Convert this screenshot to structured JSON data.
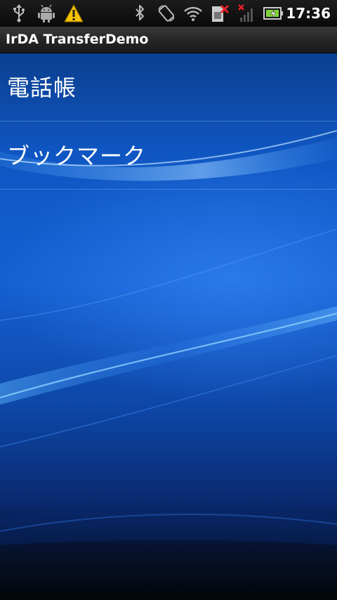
{
  "status_bar": {
    "time": "17:36",
    "left_icons": [
      "usb-icon",
      "android-debug-icon",
      "warning-icon"
    ],
    "right_icons": [
      "bluetooth-icon",
      "auto-rotate-icon",
      "wifi-icon",
      "sim-error-icon",
      "no-signal-icon",
      "battery-icon"
    ],
    "colors": {
      "warning": "#f6c300",
      "error": "#e8212a",
      "battery": "#7fd43a"
    }
  },
  "title_bar": {
    "title": "IrDA TransferDemo"
  },
  "list": {
    "items": [
      {
        "label": "電話帳"
      },
      {
        "label": "ブックマーク"
      }
    ]
  },
  "theme": {
    "wallpaper_top": "#0a3e8e",
    "wallpaper_mid": "#1d6ee6",
    "wallpaper_bottom": "#061128"
  }
}
